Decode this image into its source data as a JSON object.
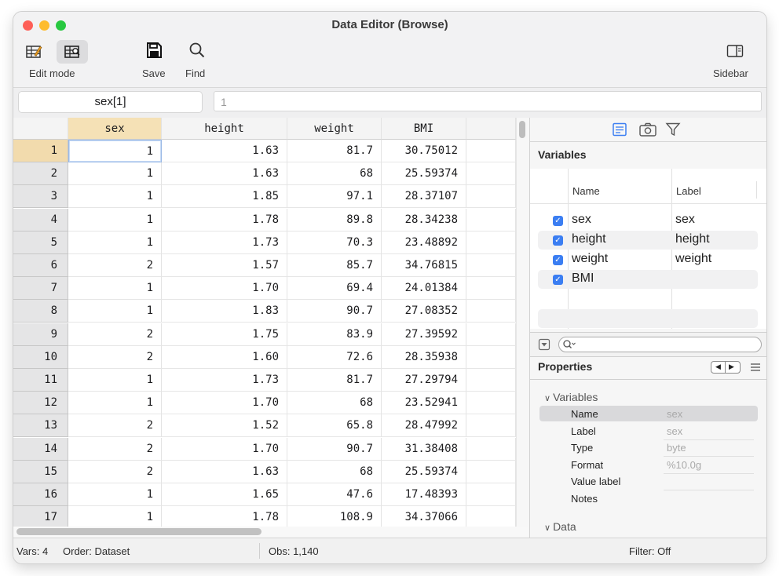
{
  "window": {
    "title": "Data Editor (Browse)"
  },
  "toolbar": {
    "edit_mode_label": "Edit mode",
    "save_label": "Save",
    "find_label": "Find",
    "sidebar_label": "Sidebar"
  },
  "formula_bar": {
    "cell_ref": "sex[1]",
    "cell_value": "1"
  },
  "grid": {
    "columns": [
      "sex",
      "height",
      "weight",
      "BMI"
    ],
    "rows": [
      [
        "1",
        "1",
        "1.63",
        "81.7",
        "30.75012"
      ],
      [
        "2",
        "1",
        "1.63",
        "68",
        "25.59374"
      ],
      [
        "3",
        "1",
        "1.85",
        "97.1",
        "28.37107"
      ],
      [
        "4",
        "1",
        "1.78",
        "89.8",
        "28.34238"
      ],
      [
        "5",
        "1",
        "1.73",
        "70.3",
        "23.48892"
      ],
      [
        "6",
        "2",
        "1.57",
        "85.7",
        "34.76815"
      ],
      [
        "7",
        "1",
        "1.70",
        "69.4",
        "24.01384"
      ],
      [
        "8",
        "1",
        "1.83",
        "90.7",
        "27.08352"
      ],
      [
        "9",
        "2",
        "1.75",
        "83.9",
        "27.39592"
      ],
      [
        "10",
        "2",
        "1.60",
        "72.6",
        "28.35938"
      ],
      [
        "11",
        "1",
        "1.73",
        "81.7",
        "27.29794"
      ],
      [
        "12",
        "1",
        "1.70",
        "68",
        "23.52941"
      ],
      [
        "13",
        "2",
        "1.52",
        "65.8",
        "28.47992"
      ],
      [
        "14",
        "2",
        "1.70",
        "90.7",
        "31.38408"
      ],
      [
        "15",
        "2",
        "1.63",
        "68",
        "25.59374"
      ],
      [
        "16",
        "1",
        "1.65",
        "47.6",
        "17.48393"
      ],
      [
        "17",
        "1",
        "1.78",
        "108.9",
        "34.37066"
      ]
    ]
  },
  "variables_panel": {
    "title": "Variables",
    "col_name": "Name",
    "col_label": "Label",
    "items": [
      {
        "name": "sex",
        "label": "sex"
      },
      {
        "name": "height",
        "label": "height"
      },
      {
        "name": "weight",
        "label": "weight"
      },
      {
        "name": "BMI",
        "label": ""
      }
    ]
  },
  "properties_panel": {
    "title": "Properties",
    "variables_section": "Variables",
    "data_section": "Data",
    "rows": [
      {
        "key": "Name",
        "value": "sex"
      },
      {
        "key": "Label",
        "value": "sex"
      },
      {
        "key": "Type",
        "value": "byte"
      },
      {
        "key": "Format",
        "value": "%10.0g"
      },
      {
        "key": "Value label",
        "value": ""
      },
      {
        "key": "Notes",
        "value": ""
      }
    ]
  },
  "status_bar": {
    "vars": "Vars: 4",
    "order": "Order: Dataset",
    "obs": "Obs: 1,140",
    "filter": "Filter: Off"
  },
  "colors": {
    "accent": "#3b7ef2",
    "selected_header": "#f5e1b6"
  }
}
